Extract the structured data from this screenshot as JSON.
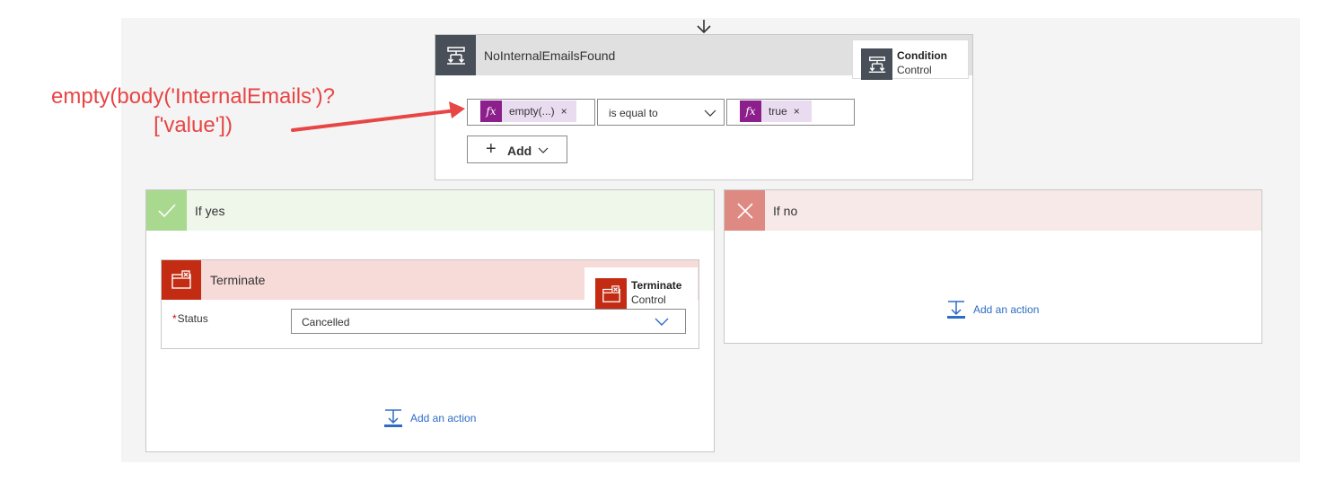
{
  "condition": {
    "title": "NoInternalEmailsFound",
    "tooltip_name": "Condition",
    "tooltip_sub": "Control",
    "left_token": "empty(...)",
    "operator": "is equal to",
    "right_token": "true",
    "add_label": "Add",
    "fx_symbol": "fx",
    "remove_symbol": "×"
  },
  "if_yes": {
    "title": "If yes",
    "terminate": {
      "title": "Terminate",
      "tooltip_name": "Terminate",
      "tooltip_sub": "Control",
      "status_label": "Status",
      "status_required_mark": "*",
      "status_value": "Cancelled"
    },
    "add_action_label": "Add an action"
  },
  "if_no": {
    "title": "If no",
    "add_action_label": "Add an action"
  },
  "annotation": {
    "line1": "empty(body('InternalEmails')?",
    "line2": "['value'])"
  },
  "colors": {
    "annotation": "#e84545",
    "yes_header": "#eef7ea",
    "yes_icon": "#a9d88f",
    "no_header": "#f7e9e7",
    "no_icon": "#de8a82",
    "link": "#2e6dc4",
    "fx_purple": "#8d1f8d",
    "terminate_red": "#c32b12"
  }
}
